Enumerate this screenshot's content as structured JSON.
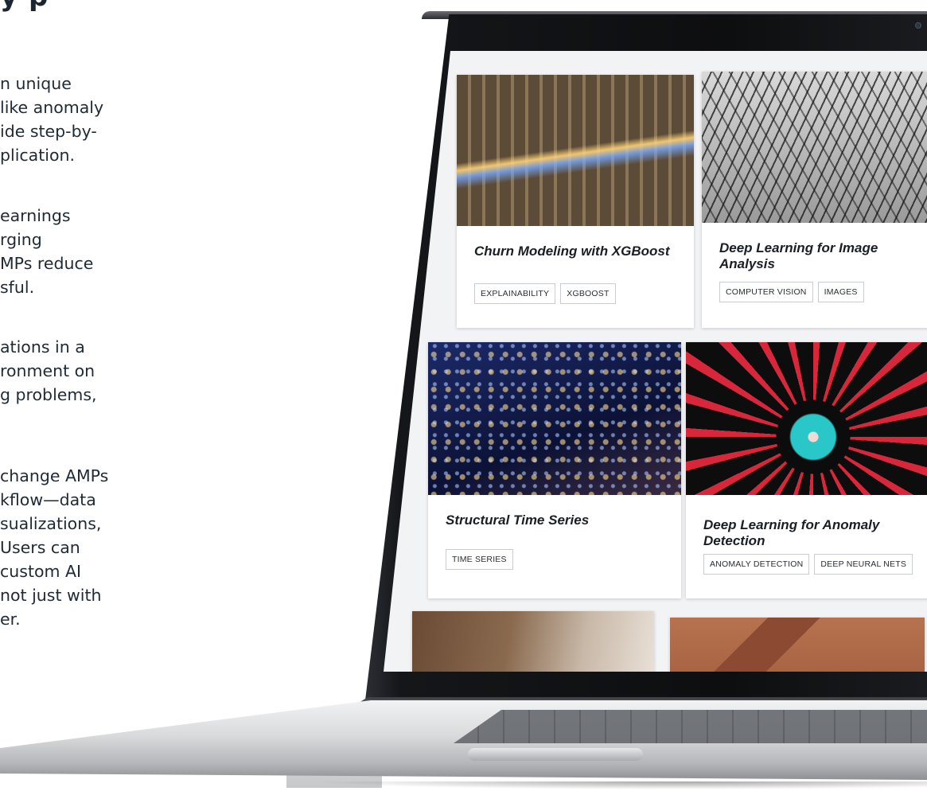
{
  "left_text": {
    "heading_fragment": "y p",
    "paragraph1": [
      "n unique",
      "like anomaly",
      "ide step-by-",
      "plication."
    ],
    "paragraph2": [
      "earnings",
      "rging",
      "MPs reduce",
      "sful."
    ],
    "paragraph3": [
      "ations in a",
      "ronment on",
      "g problems,"
    ],
    "paragraph4": [
      "change AMPs",
      "kflow—data",
      "sualizations,",
      "Users can",
      "custom AI",
      "not just with",
      "er."
    ]
  },
  "cards": [
    {
      "title": "Churn Modeling with XGBoost",
      "tags": [
        "EXPLAINABILITY",
        "XGBOOST"
      ],
      "image": "subway-station-motion-photo"
    },
    {
      "title": "Deep Learning for Image Analysis",
      "tags": [
        "COMPUTER VISION",
        "IMAGES"
      ],
      "image": "railway-tracks-aerial-photo"
    },
    {
      "title": "Structural Time Series",
      "tags": [
        "TIME SERIES"
      ],
      "image": "city-night-aerial-photo"
    },
    {
      "title": "Deep Learning for Anomaly Detection",
      "tags": [
        "ANOMALY DETECTION",
        "DEEP NEURAL NETS"
      ],
      "image": "ferris-wheel-lights-photo"
    },
    {
      "title": "",
      "tags": [],
      "image": "person-laptop-desk-photo"
    },
    {
      "title": "",
      "tags": [],
      "image": "airplane-over-field-photo"
    }
  ],
  "colors": {
    "page_background": "#ffffff",
    "screen_background": "#f2f3f5",
    "body_text": "#1f2a35",
    "tag_border": "#c9cdd2"
  }
}
